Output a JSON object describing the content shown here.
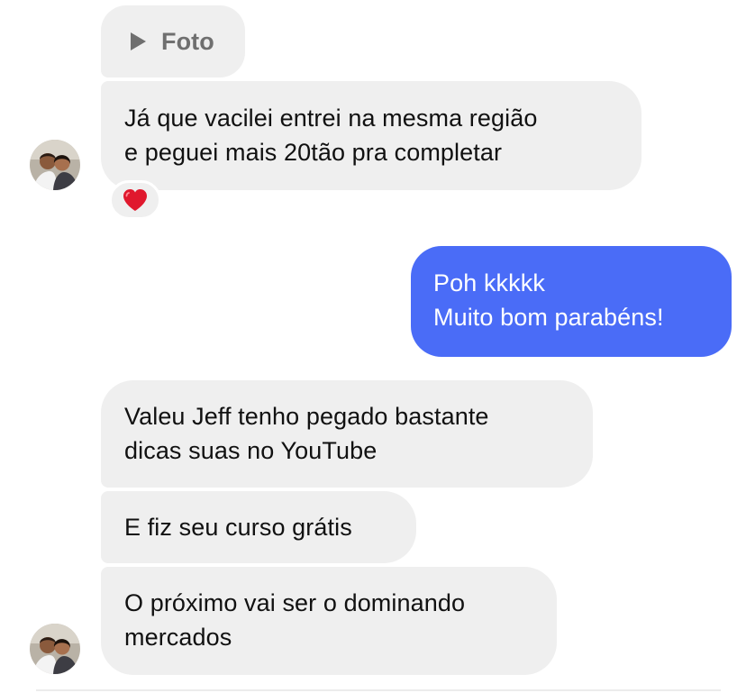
{
  "conversation": {
    "messages": [
      {
        "sender": "them",
        "type": "attachment",
        "label": "Foto"
      },
      {
        "sender": "them",
        "lines": [
          "Já que vacilei entrei na mesma região",
          "e peguei mais 20tão pra completar"
        ],
        "reaction": "❤️"
      },
      {
        "sender": "me",
        "lines": [
          "Poh kkkkk",
          "Muito bom parabéns!"
        ]
      },
      {
        "sender": "them",
        "lines": [
          "Valeu Jeff tenho pegado bastante",
          "dicas suas no YouTube"
        ]
      },
      {
        "sender": "them",
        "lines": [
          "E fiz seu curso grátis"
        ]
      },
      {
        "sender": "them",
        "lines": [
          "O próximo vai ser o dominando",
          "mercados"
        ]
      }
    ]
  },
  "colors": {
    "incoming_bubble": "#efefef",
    "outgoing_bubble": "#4a6cf7",
    "incoming_text": "#111111",
    "outgoing_text": "#ffffff",
    "attachment_text": "#6f6f6f"
  },
  "icons": {
    "attachment": "play-icon",
    "reaction": "heart-icon",
    "contact_avatar": "avatar"
  }
}
